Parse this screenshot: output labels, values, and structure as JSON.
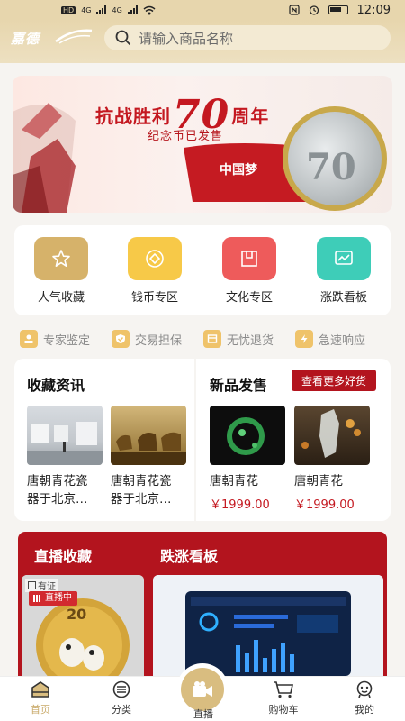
{
  "statusbar": {
    "net1": "HD",
    "net2": "4G",
    "net3": "4G",
    "time": "12:09"
  },
  "header": {
    "logo": "嘉德",
    "search_placeholder": "请输入商品名称"
  },
  "banner": {
    "title_pre": "抗战胜利",
    "title_num": "70",
    "title_post": "周年",
    "subtitle": "纪念币已发售",
    "dream": "中国梦",
    "coin_text": "70"
  },
  "categories": [
    {
      "label": "人气收藏",
      "color": "#d6b26a"
    },
    {
      "label": "钱币专区",
      "color": "#f7c948"
    },
    {
      "label": "文化专区",
      "color": "#ee5b5b"
    },
    {
      "label": "涨跌看板",
      "color": "#3ecdb8"
    }
  ],
  "guarantees": [
    "专家鉴定",
    "交易担保",
    "无忧退货",
    "急速响应"
  ],
  "news": {
    "title": "收藏资讯",
    "items": [
      {
        "title_l1": "唐朝青花瓷",
        "title_l2": "器于北京…"
      },
      {
        "title_l1": "唐朝青花瓷",
        "title_l2": "器于北京…"
      }
    ]
  },
  "new_products": {
    "title": "新品发售",
    "more": "查看更多好货",
    "items": [
      {
        "title": "唐朝青花",
        "price": "￥1999.00"
      },
      {
        "title": "唐朝青花",
        "price": "￥1999.00"
      }
    ]
  },
  "live": {
    "tab1": "直播收藏",
    "tab2": "跌涨看板",
    "verified": "有证",
    "badge": "直播中",
    "coin_num": "20"
  },
  "nav": {
    "home": "首页",
    "category": "分类",
    "live": "直播",
    "cart": "购物车",
    "mine": "我的"
  }
}
